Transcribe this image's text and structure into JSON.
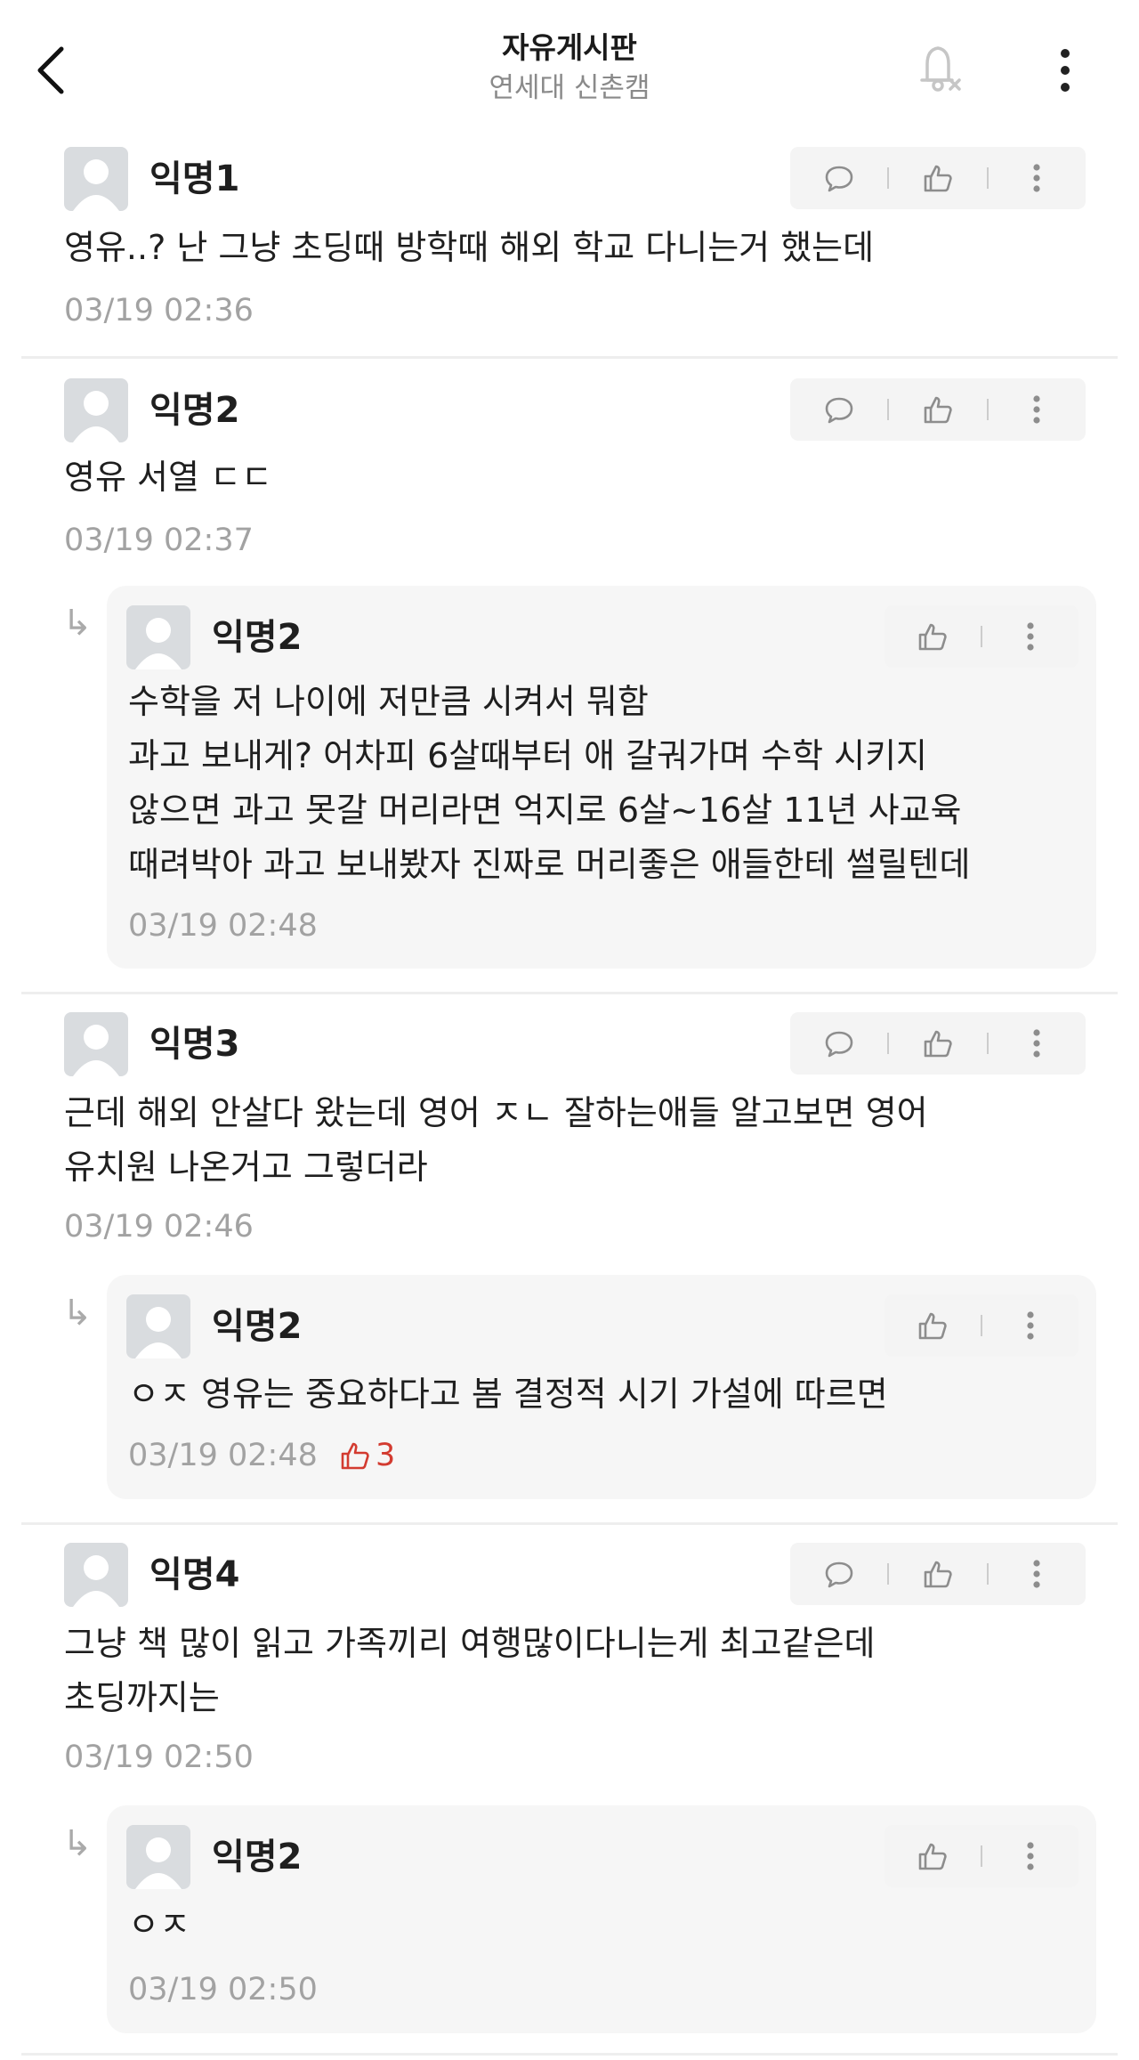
{
  "header": {
    "title": "자유게시판",
    "subtitle": "연세대 신촌캠",
    "icons": {
      "back": "chevron-left-icon",
      "notify": "bell-off-icon",
      "more": "more-vertical-icon"
    }
  },
  "comments": [
    {
      "author": "익명1",
      "lines": [
        "영유..? 난 그냥 초딩때 방학때 해외 학교 다니는거 했는데"
      ],
      "time": "03/19 02:36",
      "replies": []
    },
    {
      "author": "익명2",
      "lines": [
        "영유 서열 ㄷㄷ"
      ],
      "time": "03/19 02:37",
      "replies": [
        {
          "author": "익명2",
          "lines": [
            "수학을 저 나이에 저만큼 시켜서 뭐함",
            "과고 보내게? 어차피 6살때부터 애 갈궈가며 수학 시키지",
            "않으면 과고 못갈 머리라면 억지로 6살~16살 11년 사교육",
            "때려박아 과고 보내봤자 진짜로 머리좋은 애들한테 썰릴텐데"
          ],
          "time": "03/19 02:48",
          "likes": ""
        }
      ]
    },
    {
      "author": "익명3",
      "lines": [
        "근데 해외 안살다 왔는데 영어 ㅈㄴ 잘하는애들 알고보면 영어",
        "유치원 나온거고 그렇더라"
      ],
      "time": "03/19 02:46",
      "replies": [
        {
          "author": "익명2",
          "lines": [
            "ㅇㅈ 영유는 중요하다고 봄 결정적 시기 가설에 따르면"
          ],
          "time": "03/19 02:48",
          "likes": "3"
        }
      ]
    },
    {
      "author": "익명4",
      "lines": [
        "그냥 책 많이 읽고 가족끼리 여행많이다니는게 최고같은데",
        "초딩까지는"
      ],
      "time": "03/19 02:50",
      "replies": [
        {
          "author": "익명2",
          "lines": [
            "ㅇㅈ"
          ],
          "time": "03/19 02:50",
          "likes": ""
        }
      ]
    }
  ],
  "colors": {
    "accent_like": "#d33b30",
    "meta_text": "#a2a2a2",
    "reply_bg": "#f6f6f6",
    "action_bg": "#f4f4f4"
  }
}
